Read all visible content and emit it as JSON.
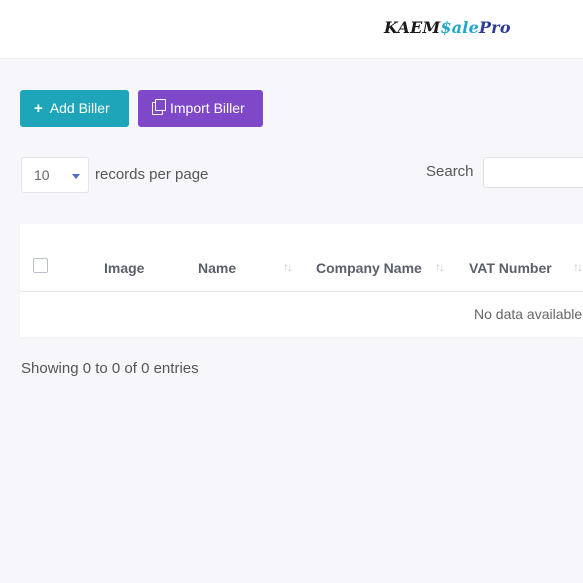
{
  "brand": {
    "part1": "KAEM",
    "part2": "$ale",
    "part3": "Pro",
    "colors": {
      "dark": "#1a1a1a",
      "teal": "#1fa8c9",
      "navy": "#2f3c9a"
    }
  },
  "toolbar": {
    "add_icon": "plus-icon",
    "add_label": "Add Biller",
    "add_color": "#1fa5b9",
    "import_icon": "clipboard-icon",
    "import_label": "Import Biller",
    "import_color": "#7f48c9"
  },
  "controls": {
    "per_page_value": "10",
    "per_page_label": "records per page",
    "search_label": "Search",
    "search_value": ""
  },
  "table": {
    "columns": [
      {
        "label": "Image",
        "sortable": false
      },
      {
        "label": "Name",
        "sortable": true
      },
      {
        "label": "Company Name",
        "sortable": true
      },
      {
        "label": "VAT Number",
        "sortable": true
      }
    ],
    "sort_glyph": "↑↓",
    "empty_text": "No data available"
  },
  "footer": {
    "showing": "Showing 0 to 0 of 0 entries"
  }
}
